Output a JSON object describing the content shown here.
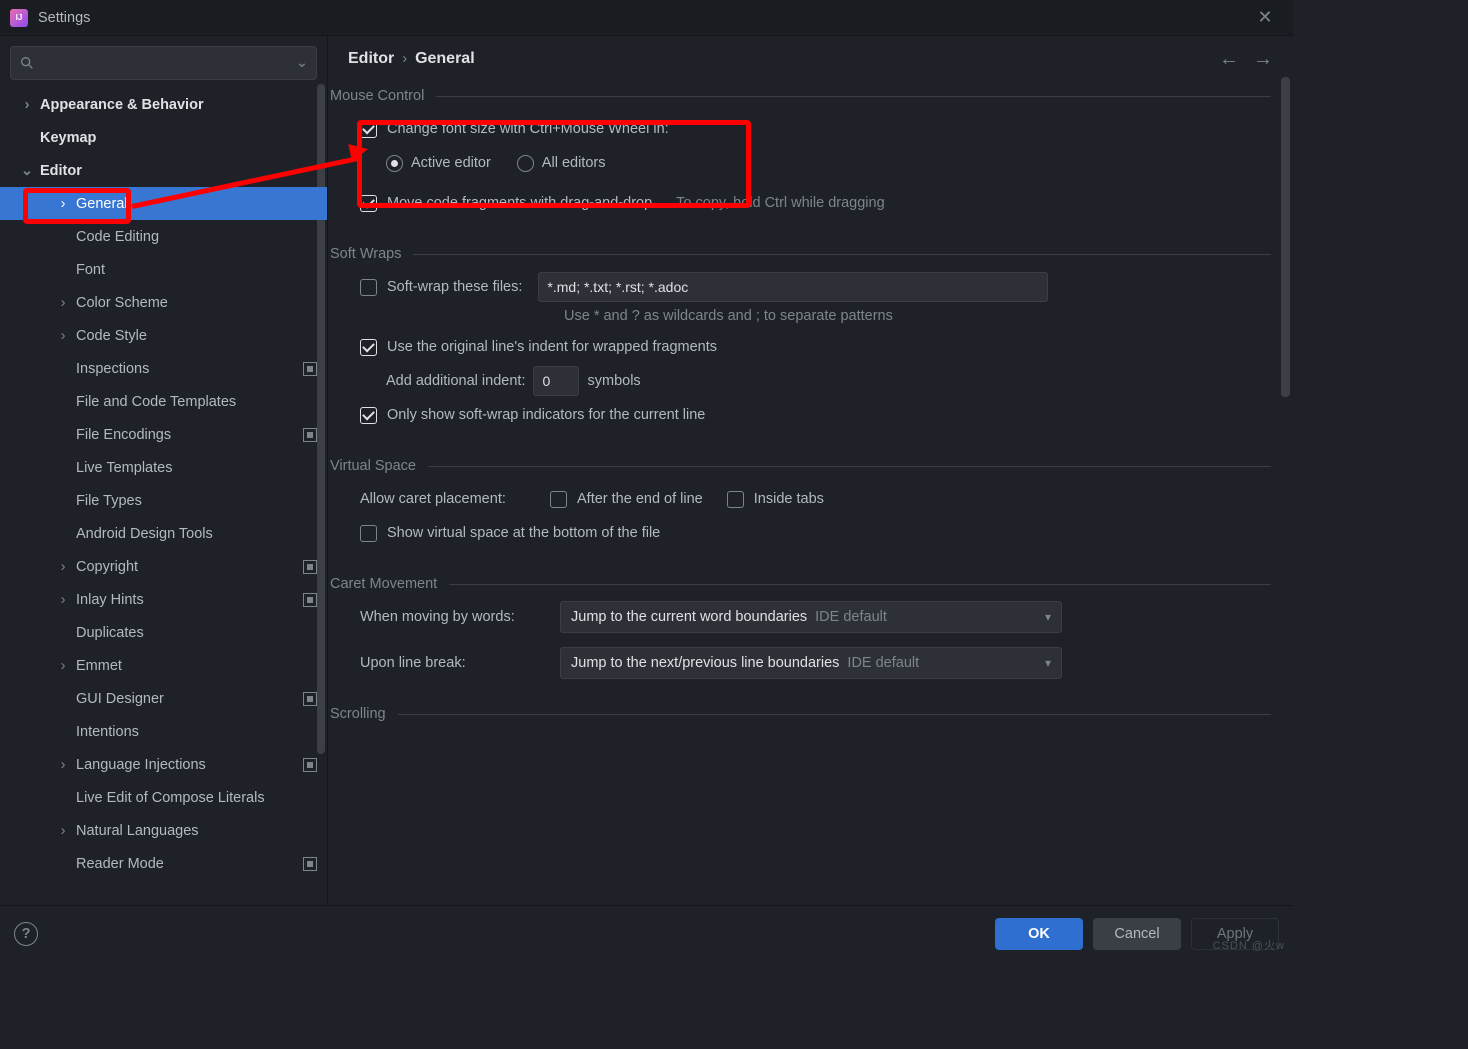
{
  "window": {
    "title": "Settings"
  },
  "breadcrumb": {
    "root": "Editor",
    "sep": "›",
    "leaf": "General"
  },
  "sidebar": {
    "search_placeholder": "",
    "items": [
      {
        "label": "Appearance & Behavior",
        "level": 1,
        "chev": ">"
      },
      {
        "label": "Keymap",
        "level": 1,
        "chev": ""
      },
      {
        "label": "Editor",
        "level": 1,
        "chev": "⌄"
      },
      {
        "label": "General",
        "level": 2,
        "chev": ">",
        "selected": true
      },
      {
        "label": "Code Editing",
        "level": 2,
        "chev": ""
      },
      {
        "label": "Font",
        "level": 2,
        "chev": ""
      },
      {
        "label": "Color Scheme",
        "level": 2,
        "chev": ">"
      },
      {
        "label": "Code Style",
        "level": 2,
        "chev": ">"
      },
      {
        "label": "Inspections",
        "level": 2,
        "chev": "",
        "badge": true
      },
      {
        "label": "File and Code Templates",
        "level": 2,
        "chev": ""
      },
      {
        "label": "File Encodings",
        "level": 2,
        "chev": "",
        "badge": true
      },
      {
        "label": "Live Templates",
        "level": 2,
        "chev": ""
      },
      {
        "label": "File Types",
        "level": 2,
        "chev": ""
      },
      {
        "label": "Android Design Tools",
        "level": 2,
        "chev": ""
      },
      {
        "label": "Copyright",
        "level": 2,
        "chev": ">",
        "badge": true
      },
      {
        "label": "Inlay Hints",
        "level": 2,
        "chev": ">",
        "badge": true
      },
      {
        "label": "Duplicates",
        "level": 2,
        "chev": ""
      },
      {
        "label": "Emmet",
        "level": 2,
        "chev": ">"
      },
      {
        "label": "GUI Designer",
        "level": 2,
        "chev": "",
        "badge": true
      },
      {
        "label": "Intentions",
        "level": 2,
        "chev": ""
      },
      {
        "label": "Language Injections",
        "level": 2,
        "chev": ">",
        "badge": true
      },
      {
        "label": "Live Edit of Compose Literals",
        "level": 2,
        "chev": ""
      },
      {
        "label": "Natural Languages",
        "level": 2,
        "chev": ">"
      },
      {
        "label": "Reader Mode",
        "level": 2,
        "chev": "",
        "badge": true
      }
    ]
  },
  "sections": {
    "mouse_control": {
      "title": "Mouse Control",
      "change_font_label": "Change font size with Ctrl+Mouse Wheel in:",
      "active_editor": "Active editor",
      "all_editors": "All editors",
      "drag_drop": "Move code fragments with drag-and-drop",
      "drag_hint": "To copy, hold Ctrl while dragging"
    },
    "soft_wraps": {
      "title": "Soft Wraps",
      "soft_wrap_label": "Soft-wrap these files:",
      "soft_wrap_value": "*.md; *.txt; *.rst; *.adoc",
      "note": "Use * and ? as wildcards and ; to separate patterns",
      "use_indent": "Use the original line's indent for wrapped fragments",
      "add_indent_label": "Add additional indent:",
      "add_indent_value": "0",
      "symbols": "symbols",
      "only_show": "Only show soft-wrap indicators for the current line"
    },
    "virtual_space": {
      "title": "Virtual Space",
      "allow_caret": "Allow caret placement:",
      "after_eol": "After the end of line",
      "inside_tabs": "Inside tabs",
      "show_bottom": "Show virtual space at the bottom of the file"
    },
    "caret_movement": {
      "title": "Caret Movement",
      "by_words_label": "When moving by words:",
      "by_words_value": "Jump to the current word boundaries",
      "line_break_label": "Upon line break:",
      "line_break_value": "Jump to the next/previous line boundaries",
      "ide_default": "IDE default"
    },
    "scrolling": {
      "title": "Scrolling"
    }
  },
  "footer": {
    "ok": "OK",
    "cancel": "Cancel",
    "apply": "Apply",
    "help": "?"
  },
  "watermark": "CSDN @火w"
}
